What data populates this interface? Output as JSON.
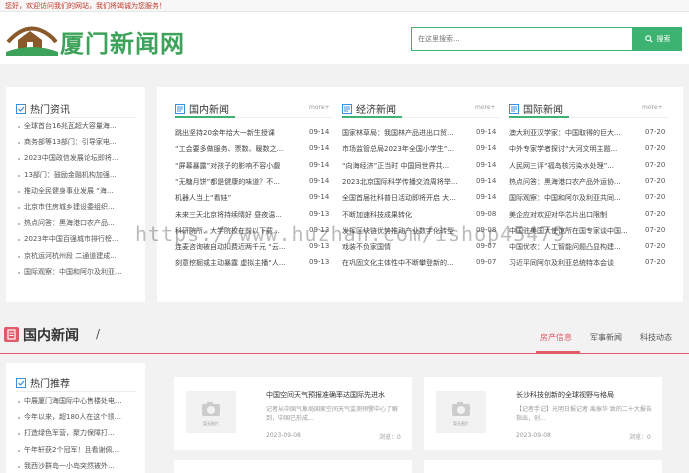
{
  "topbar": {
    "welcome": "您好，欢迎访问我们的网站，我们将竭诚为您服务！"
  },
  "header": {
    "site_name": "厦门新闻网",
    "search_placeholder": "在这里搜索...",
    "search_button": "搜索"
  },
  "hot_news": {
    "title": "热门资讯",
    "items": [
      "全球首台16兆瓦超大容量海...",
      "商务部等13部门：引导家电...",
      "2023中国政信发展论坛即将...",
      "13部门：鼓励金融机构加强...",
      "推动全民健身事业发展 “海...",
      "北京市住房城乡建设委组织...",
      "热点问答：黑海港口农产品...",
      "2023年中国百强城市排行榜...",
      "京杭运河杭州段 二通道建成...",
      "国际观察：中国和阿尔及利亚..."
    ]
  },
  "domestic": {
    "title": "国内新闻",
    "more": "more+",
    "rows": [
      {
        "title": "跳出坚持20余年给大一新生授课",
        "date": "09-14"
      },
      {
        "title": "“工会要多做服务、票数、暖数之...",
        "date": "09-14"
      },
      {
        "title": "“屏幕暴露”对孩子的影响不容小觑",
        "date": "09-14"
      },
      {
        "title": "“无糖月饼”都是健康的味道？不...",
        "date": "09-14"
      },
      {
        "title": "机器人当上“看娃”",
        "date": "09-14"
      },
      {
        "title": "未来三天北京将持续晴好 昼夜温...",
        "date": "09-13"
      },
      {
        "title": "科研院所、大学院校在前以下载...",
        "date": "09-13"
      },
      {
        "title": "连麦咨询被自动扣费近两千元 “云...",
        "date": "09-13"
      },
      {
        "title": "刻意挖掘或主动暴露 虚拟主播“人...",
        "date": "09-13"
      }
    ]
  },
  "economy": {
    "title": "经济新闻",
    "more": "more+",
    "rows": [
      {
        "title": "国家林草局：我国林产品进出口贸...",
        "date": "09-14"
      },
      {
        "title": "市场监管总局2023年全国小学生“...",
        "date": "09-14"
      },
      {
        "title": "“向海经济”正当时 中国同世界共...",
        "date": "09-14"
      },
      {
        "title": "2023北京国际科学传播交流周将举...",
        "date": "09-14"
      },
      {
        "title": "全国首届社科普日活动即将开启 大...",
        "date": "09-14"
      },
      {
        "title": "不断加速科技成果转化",
        "date": "09-08"
      },
      {
        "title": "发挥区块链优势推动产业数字化转型",
        "date": "09-08"
      },
      {
        "title": "戏装不负家国情",
        "date": "09-07"
      },
      {
        "title": "在巩固文化主体性中不断攀登新的...",
        "date": "09-07"
      }
    ]
  },
  "international": {
    "title": "国际新闻",
    "more": "more+",
    "rows": [
      {
        "title": "澳大利亚汉学家：中国取得的巨大...",
        "date": "07-20"
      },
      {
        "title": "中外专家学者探讨“大河文明主题...",
        "date": "07-20"
      },
      {
        "title": "人民网三评“福岛核污染水处理”...",
        "date": "07-20"
      },
      {
        "title": "热点问答：黑海港口农产品外运协...",
        "date": "07-20"
      },
      {
        "title": "国际观察：中国和阿尔及利亚共同...",
        "date": "07-20"
      },
      {
        "title": "美企应对欢迎对华芯片出口限制",
        "date": "07-20"
      },
      {
        "title": "中国驻美国大使馆所在国专家谈中国...",
        "date": "07-20"
      },
      {
        "title": "中国优农：人工智能问题凸显构建...",
        "date": "07-20"
      },
      {
        "title": "习近平同阿尔及利亚总统特本会谈",
        "date": "07-20"
      }
    ]
  },
  "watermark": "https://www.huzhan.com/ishop45479",
  "section": {
    "title": "国内新闻",
    "slash": "/",
    "tabs": [
      "房产信息",
      "军事新闻",
      "科技动态"
    ]
  },
  "recommend": {
    "title": "热门推荐",
    "items": [
      "中展厦门海国际中心售楼处电...",
      "今年以来，超180人在这个领...",
      "打造绿色军营，聚力保障打...",
      "午年轩获2个冠军！且看谢佩...",
      "我西沙群岛一小岛突然被外..."
    ]
  },
  "cards": [
    {
      "thumb_label": "暂无图片",
      "title": "中国空间天气预报准确率达国际先进水",
      "desc": "记者从中国气象局国家空间天气监测预警中心了解到，中国已形成...",
      "date": "2023-09-08",
      "views": "浏览：0"
    },
    {
      "thumb_label": "暂无图片",
      "title": "长沙科技创新的全球视野与格局",
      "desc": "【记者手记】光明日报记者 禹振华 致的二十大报告指出，创...",
      "date": "2023-09-08",
      "views": "浏览：0"
    }
  ],
  "colors": {
    "accent_green": "#3cb371",
    "accent_red": "#e05a6a",
    "topbar_text": "#c0392b"
  }
}
